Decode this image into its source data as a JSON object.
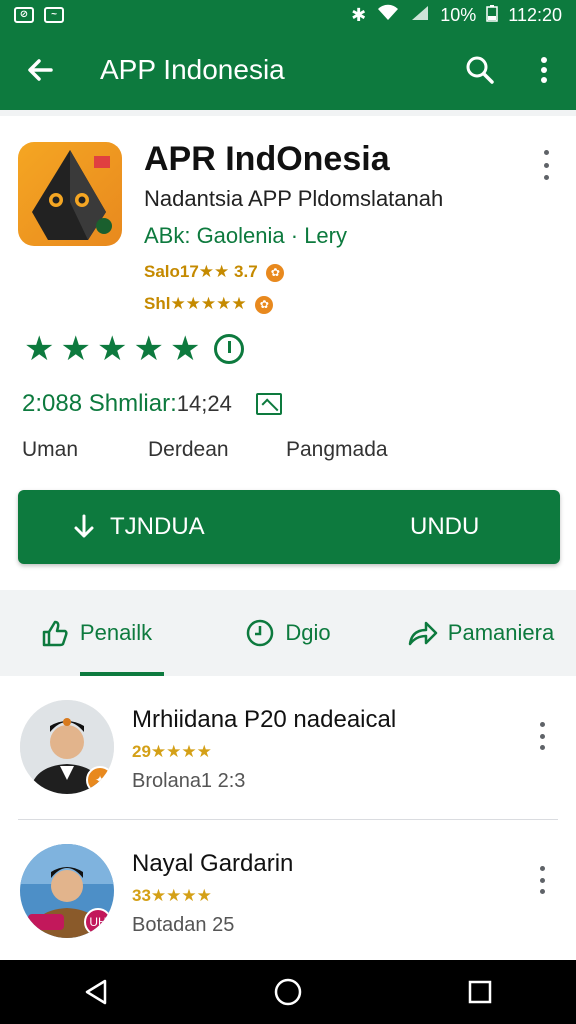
{
  "status_bar": {
    "battery": "10%",
    "time": "112:20"
  },
  "app_bar": {
    "title": "APP Indonesia"
  },
  "app": {
    "name": "APR IndOnesia",
    "subtitle": "Nadantsia APP Pldomslatanah",
    "developer": "ABk: Gaolenia · Lery",
    "meta_line1": "Salo17★★ 3.7",
    "meta_line2": "Shl★★★★★",
    "stars": 5,
    "stats": {
      "value": "2:088",
      "label": "Shmliar:",
      "extra": "14;24"
    },
    "labels": [
      "Uman",
      "Derdean",
      "Pangmada"
    ]
  },
  "install": {
    "left_label": "TJNDUA",
    "right_label": "UNDU"
  },
  "tabs": [
    {
      "label": "Penailk",
      "active": true
    },
    {
      "label": "Dgio",
      "active": false
    },
    {
      "label": "Pamaniera",
      "active": false
    }
  ],
  "list": [
    {
      "name": "Mrhiidana P20 nadeaical",
      "rating": "29★★★★",
      "sub": "Brolana1 2:3",
      "badge": "✦"
    },
    {
      "name": "Nayal Gardarin",
      "rating": "33★★★★",
      "sub": "Botadan 25",
      "badge": "UH"
    }
  ],
  "colors": {
    "primary": "#0d7a3e",
    "accent": "#e8891e",
    "star_gold": "#d4a017"
  }
}
